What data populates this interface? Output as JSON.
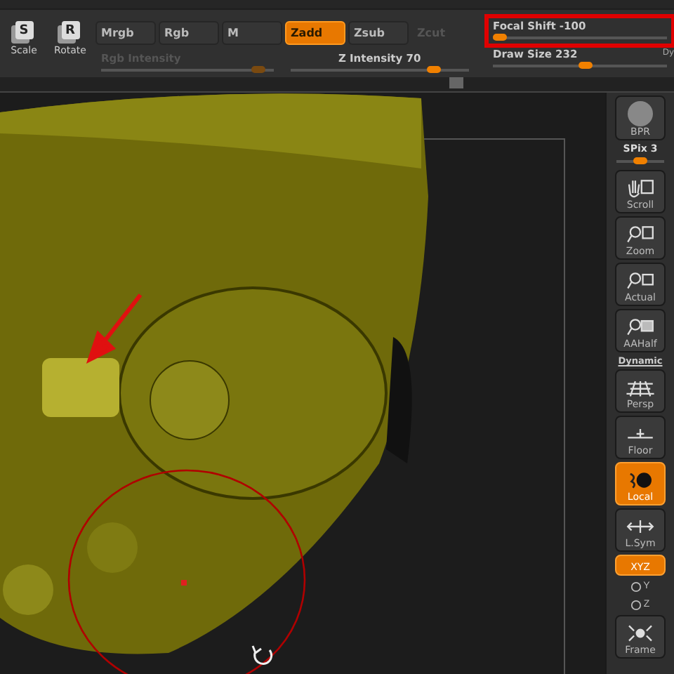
{
  "transform_tools": [
    {
      "key": "S",
      "label": "Scale"
    },
    {
      "key": "R",
      "label": "Rotate"
    }
  ],
  "mode_buttons": [
    {
      "label": "Mrgb",
      "selected": false,
      "disabled": false
    },
    {
      "label": "Rgb",
      "selected": false,
      "disabled": false
    },
    {
      "label": "M",
      "selected": false,
      "disabled": false
    },
    {
      "label": "Zadd",
      "selected": true,
      "disabled": false
    },
    {
      "label": "Zsub",
      "selected": false,
      "disabled": false
    },
    {
      "label": "Zcut",
      "selected": false,
      "disabled": true
    }
  ],
  "sliders": [
    {
      "label": "Rgb Intensity",
      "level": 0.97,
      "disabled": true,
      "highlighted": false
    },
    {
      "label": "Z Intensity 70",
      "level": 0.85,
      "disabled": false,
      "highlighted": false
    },
    {
      "label": "Focal Shift -100",
      "level": 0.0,
      "disabled": false,
      "highlighted": true
    },
    {
      "label": "Draw Size 232",
      "level": 0.55,
      "disabled": false,
      "highlighted": false
    }
  ],
  "edge_label": "Dy",
  "shelf": [
    {
      "kind": "sphere",
      "label": "BPR",
      "on": false
    },
    {
      "kind": "slider",
      "label": "SPix 3",
      "level": 0.5
    },
    {
      "kind": "hand",
      "label": "Scroll",
      "on": false
    },
    {
      "kind": "zoom",
      "label": "Zoom",
      "on": false
    },
    {
      "kind": "actual",
      "label": "Actual",
      "on": false
    },
    {
      "kind": "aahalf",
      "label": "AAHalf",
      "on": false
    },
    {
      "kind": "grid",
      "label": "Persp",
      "caption": "Dynamic",
      "on": false
    },
    {
      "kind": "floor",
      "label": "Floor",
      "on": false
    },
    {
      "kind": "local",
      "label": "Local",
      "on": true
    },
    {
      "kind": "sym",
      "label": "L.Sym",
      "on": false
    },
    {
      "kind": "small",
      "label": "XYZ",
      "on": true
    },
    {
      "kind": "axis",
      "label": "Y"
    },
    {
      "kind": "axis",
      "label": "Z"
    },
    {
      "kind": "frame",
      "label": "Frame",
      "on": false
    }
  ]
}
